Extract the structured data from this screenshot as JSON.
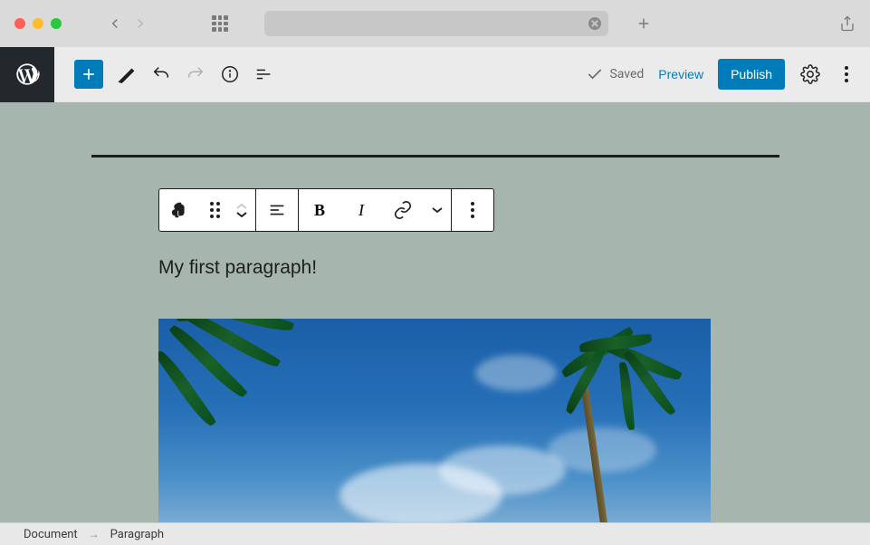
{
  "header": {
    "saved_label": "Saved",
    "preview_label": "Preview",
    "publish_label": "Publish"
  },
  "content": {
    "paragraph_text": "My first paragraph!"
  },
  "breadcrumb": {
    "root": "Document",
    "current": "Paragraph"
  }
}
